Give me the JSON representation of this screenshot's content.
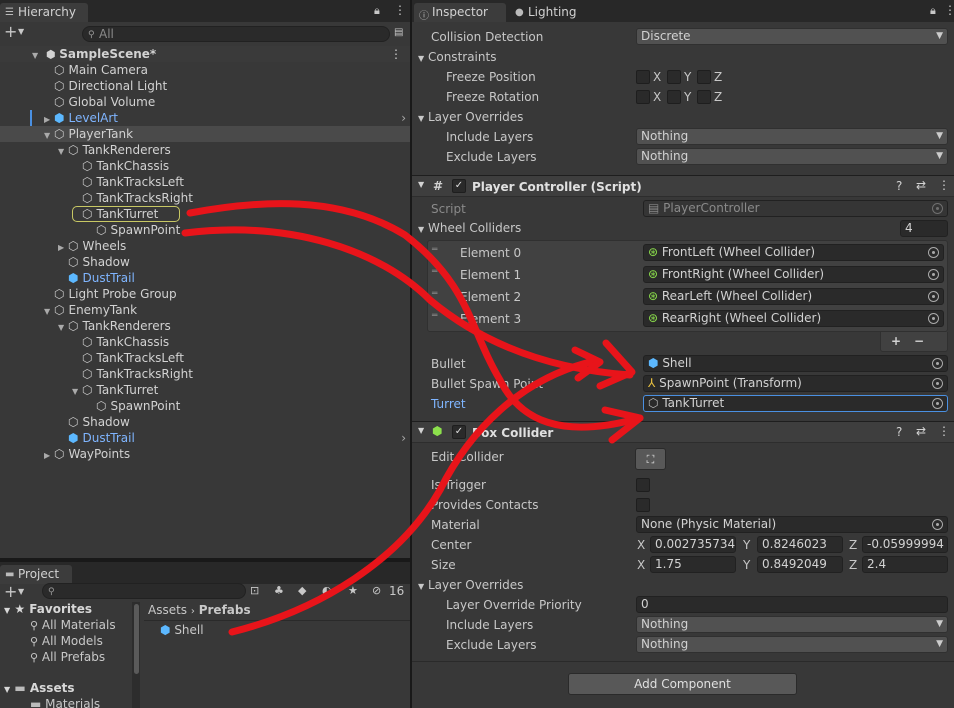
{
  "hierarchy": {
    "tab_label": "Hierarchy",
    "search_placeholder": "All",
    "scene_name": "SampleScene*",
    "items": [
      {
        "label": "Main Camera"
      },
      {
        "label": "Directional Light"
      },
      {
        "label": "Global Volume"
      },
      {
        "label": "LevelArt"
      },
      {
        "label": "PlayerTank"
      },
      {
        "label": "TankRenderers"
      },
      {
        "label": "TankChassis"
      },
      {
        "label": "TankTracksLeft"
      },
      {
        "label": "TankTracksRight"
      },
      {
        "label": "TankTurret"
      },
      {
        "label": "SpawnPoint"
      },
      {
        "label": "Wheels"
      },
      {
        "label": "Shadow"
      },
      {
        "label": "DustTrail"
      },
      {
        "label": "Light Probe Group"
      },
      {
        "label": "EnemyTank"
      },
      {
        "label": "TankRenderers"
      },
      {
        "label": "TankChassis"
      },
      {
        "label": "TankTracksLeft"
      },
      {
        "label": "TankTracksRight"
      },
      {
        "label": "TankTurret"
      },
      {
        "label": "SpawnPoint"
      },
      {
        "label": "Shadow"
      },
      {
        "label": "DustTrail"
      },
      {
        "label": "WayPoints"
      }
    ]
  },
  "project": {
    "tab_label": "Project",
    "hidden_count": "16",
    "favorites_label": "Favorites",
    "favorites": [
      "All Materials",
      "All Models",
      "All Prefabs"
    ],
    "assets_label": "Assets",
    "materials_label": "Materials",
    "breadcrumb": [
      "Assets",
      "Prefabs"
    ],
    "files": [
      "Shell"
    ]
  },
  "inspector": {
    "tab_label": "Inspector",
    "lighting_tab_label": "Lighting",
    "collision_detection_label": "Collision Detection",
    "collision_detection_value": "Discrete",
    "constraints_label": "Constraints",
    "freeze_position_label": "Freeze Position",
    "freeze_rotation_label": "Freeze Rotation",
    "axis_x": "X",
    "axis_y": "Y",
    "axis_z": "Z",
    "layer_overrides_label": "Layer Overrides",
    "include_layers_label": "Include Layers",
    "exclude_layers_label": "Exclude Layers",
    "include_layers_value": "Nothing",
    "exclude_layers_value": "Nothing",
    "player_controller": {
      "title": "Player Controller (Script)",
      "script_label": "Script",
      "script_value": "PlayerController",
      "wheel_colliders_label": "Wheel Colliders",
      "wheel_colliders_count": "4",
      "elements": [
        {
          "label": "Element 0",
          "value": "FrontLeft (Wheel Collider)"
        },
        {
          "label": "Element 1",
          "value": "FrontRight (Wheel Collider)"
        },
        {
          "label": "Element 2",
          "value": "RearLeft (Wheel Collider)"
        },
        {
          "label": "Element 3",
          "value": "RearRight (Wheel Collider)"
        }
      ],
      "add_symbol": "+",
      "remove_symbol": "−",
      "bullet_label": "Bullet",
      "bullet_value": "Shell",
      "bullet_spawn_label": "Bullet Spawn Point",
      "bullet_spawn_value": "SpawnPoint (Transform)",
      "turret_label": "Turret",
      "turret_value": "TankTurret"
    },
    "box_collider": {
      "title": "Box Collider",
      "edit_collider_label": "Edit Collider",
      "is_trigger_label": "Is Trigger",
      "provides_contacts_label": "Provides Contacts",
      "material_label": "Material",
      "material_value": "None (Physic Material)",
      "center_label": "Center",
      "center": {
        "x": "0.002735734",
        "y": "0.8246023",
        "z": "-0.05999994"
      },
      "size_label": "Size",
      "size": {
        "x": "1.75",
        "y": "0.8492049",
        "z": "2.4"
      },
      "layer_overrides_label": "Layer Overrides",
      "layer_override_priority_label": "Layer Override Priority",
      "layer_override_priority_value": "0",
      "include_layers_label": "Include Layers",
      "include_layers_value": "Nothing",
      "exclude_layers_label": "Exclude Layers",
      "exclude_layers_value": "Nothing"
    },
    "add_component_label": "Add Component"
  },
  "colors": {
    "annotation_red": "#e8141a",
    "link_blue": "#7fb5ff",
    "selection_outline": "#c8c864"
  }
}
